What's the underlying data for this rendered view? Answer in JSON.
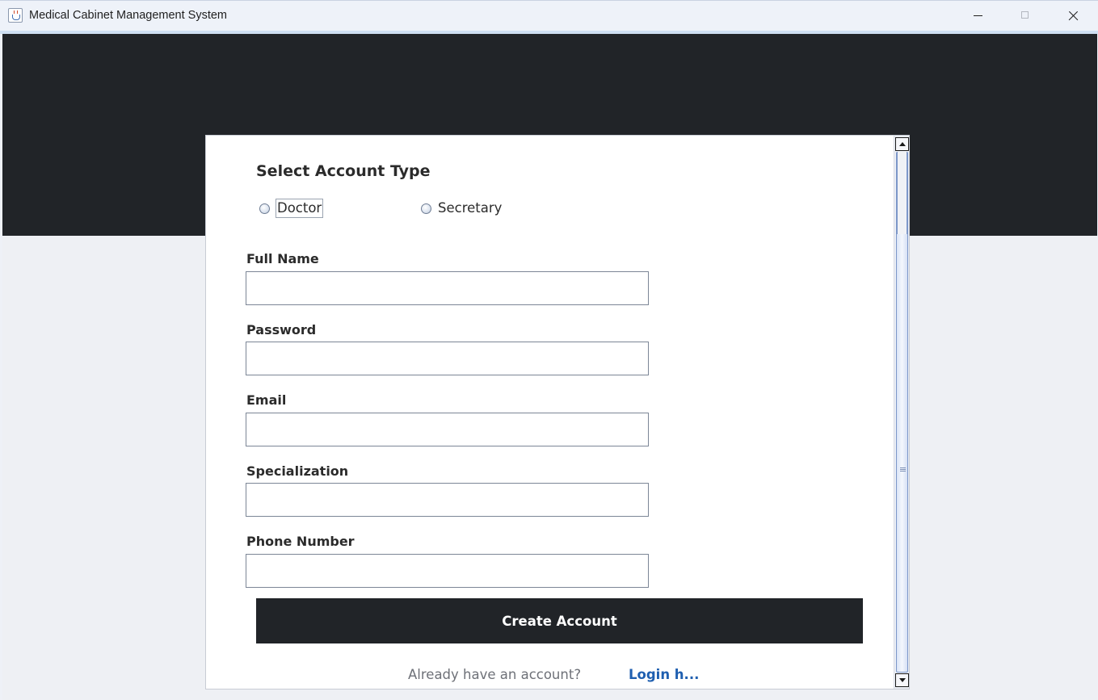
{
  "window": {
    "title": "Medical Cabinet Management System",
    "icons": {
      "app": "java-app-icon",
      "minimize": "minimize-icon",
      "maximize": "maximize-icon",
      "close": "close-icon"
    }
  },
  "form": {
    "section_title": "Select Account Type",
    "account_types": [
      {
        "label": "Doctor",
        "selected": false,
        "focused": true
      },
      {
        "label": "Secretary",
        "selected": false,
        "focused": false
      }
    ],
    "fields": [
      {
        "label": "Full Name",
        "value": ""
      },
      {
        "label": "Password",
        "value": ""
      },
      {
        "label": "Email",
        "value": ""
      },
      {
        "label": "Specialization",
        "value": ""
      },
      {
        "label": "Phone Number",
        "value": ""
      }
    ],
    "submit_label": "Create Account",
    "footer_text": "Already have an account?",
    "login_link": "Login h..."
  },
  "colors": {
    "header_band": "#212428",
    "button_bg": "#212428",
    "button_text": "#ffffff",
    "link": "#1f5fb0",
    "card_bg": "#ffffff"
  },
  "scrollbar": {
    "icons": {
      "up": "scroll-up-arrow-icon",
      "down": "scroll-down-arrow-icon",
      "grip": "scroll-grip-icon"
    }
  }
}
